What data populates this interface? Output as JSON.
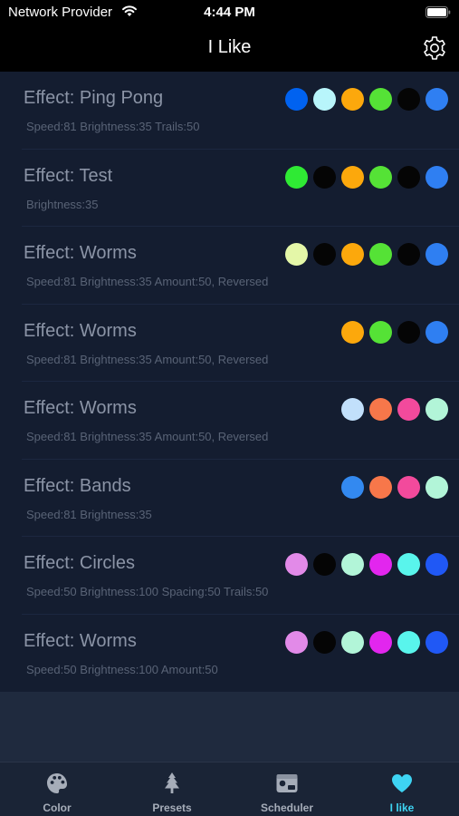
{
  "status_bar": {
    "carrier": "Network Provider",
    "time": "4:44 PM"
  },
  "nav": {
    "title": "I Like",
    "settings_icon": "gear-icon"
  },
  "presets": [
    {
      "title": "Effect: Ping Pong",
      "params": "Speed:81 Brightness:35 Trails:50",
      "colors": [
        "#0062f0",
        "#b8f5fb",
        "#fca80c",
        "#55e236",
        "#050505",
        "#2f7ff2"
      ]
    },
    {
      "title": "Effect: Test",
      "params": "Brightness:35",
      "colors": [
        "#2fea34",
        "#050505",
        "#fca80c",
        "#55e236",
        "#050505",
        "#2f7ff2"
      ]
    },
    {
      "title": "Effect: Worms",
      "params": "Speed:81 Brightness:35 Amount:50, Reversed",
      "colors": [
        "#e4f7a8",
        "#050505",
        "#fca80c",
        "#55e236",
        "#050505",
        "#2f7ff2"
      ]
    },
    {
      "title": "Effect: Worms",
      "params": "Speed:81 Brightness:35 Amount:50, Reversed",
      "colors": [
        "#fca80c",
        "#55e236",
        "#050505",
        "#2f7ff2"
      ]
    },
    {
      "title": "Effect: Worms",
      "params": "Speed:81 Brightness:35 Amount:50, Reversed",
      "colors": [
        "#c2e0fb",
        "#f7774a",
        "#f24a9c",
        "#b2f5d8"
      ]
    },
    {
      "title": "Effect: Bands",
      "params": "Speed:81 Brightness:35",
      "colors": [
        "#3389f0",
        "#f7774a",
        "#f24a9c",
        "#b2f5d8"
      ]
    },
    {
      "title": "Effect: Circles",
      "params": "Speed:50 Brightness:100 Spacing:50 Trails:50",
      "colors": [
        "#e28ae8",
        "#050505",
        "#b2f5d8",
        "#e226ee",
        "#59f5ec",
        "#2058f5"
      ]
    },
    {
      "title": "Effect: Worms",
      "params": "Speed:50 Brightness:100 Amount:50",
      "colors": [
        "#e28ae8",
        "#050505",
        "#b2f5d8",
        "#e226ee",
        "#59f5ec",
        "#2058f5"
      ]
    }
  ],
  "tabs": [
    {
      "label": "Color",
      "icon": "palette-icon",
      "active": false
    },
    {
      "label": "Presets",
      "icon": "tree-icon",
      "active": false
    },
    {
      "label": "Scheduler",
      "icon": "scheduler-icon",
      "active": false
    },
    {
      "label": "I like",
      "icon": "heart-icon",
      "active": true
    }
  ],
  "colors": {
    "accent": "#3ed4f3",
    "inactive_tab": "#a6adb9",
    "list_background": "#141d30"
  }
}
